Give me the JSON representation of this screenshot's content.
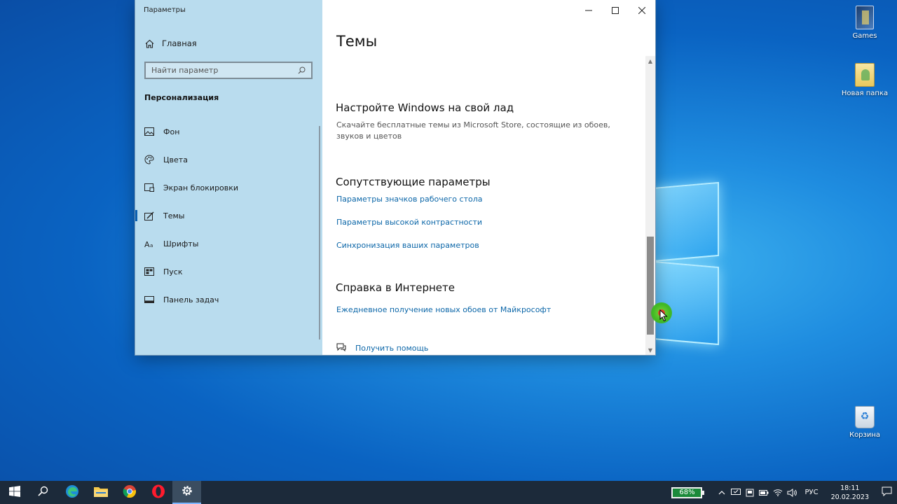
{
  "desktop": {
    "icons": [
      {
        "label": "Games",
        "icon": "games-folder-icon"
      },
      {
        "label": "Новая папка",
        "icon": "folder-icon"
      },
      {
        "label": "Корзина",
        "icon": "recycle-bin-icon"
      }
    ]
  },
  "window": {
    "title": "Параметры",
    "controls": {
      "minimize": "minimize-icon",
      "maximize": "maximize-icon",
      "close": "close-icon"
    }
  },
  "sidebar": {
    "home_label": "Главная",
    "search_placeholder": "Найти параметр",
    "section_title": "Персонализация",
    "items": [
      {
        "label": "Фон",
        "icon": "picture-icon",
        "active": false
      },
      {
        "label": "Цвета",
        "icon": "palette-icon",
        "active": false
      },
      {
        "label": "Экран блокировки",
        "icon": "lock-screen-icon",
        "active": false
      },
      {
        "label": "Темы",
        "icon": "themes-brush-icon",
        "active": true
      },
      {
        "label": "Шрифты",
        "icon": "fonts-icon",
        "active": false
      },
      {
        "label": "Пуск",
        "icon": "start-grid-icon",
        "active": false
      },
      {
        "label": "Панель задач",
        "icon": "taskbar-icon",
        "active": false
      }
    ]
  },
  "content": {
    "page_title": "Темы",
    "customize": {
      "heading": "Настройте Windows на свой лад",
      "description": "Скачайте бесплатные темы из Microsoft Store, состоящие из обоев, звуков и цветов"
    },
    "related": {
      "heading": "Сопутствующие параметры",
      "links": [
        "Параметры значков рабочего стола",
        "Параметры высокой контрастности",
        "Синхронизация ваших параметров"
      ]
    },
    "web_help": {
      "heading": "Справка в Интернете",
      "links": [
        "Ежедневное получение новых обоев от Майкрософт"
      ]
    },
    "get_help": "Получить помощь"
  },
  "taskbar": {
    "apps": [
      "windows-start-icon",
      "search-icon",
      "edge-icon",
      "file-explorer-icon",
      "chrome-icon",
      "opera-icon",
      "settings-gear-icon"
    ],
    "active_app": "settings-gear-icon",
    "battery_percent": "68%",
    "language": "РУС",
    "time": "18:11",
    "date": "20.02.2023"
  },
  "colors": {
    "accent": "#0b66a8",
    "sidebar_bg": "#b9dcee",
    "taskbar_bg": "#1c2a3a",
    "battery": "#1b8a3a"
  }
}
